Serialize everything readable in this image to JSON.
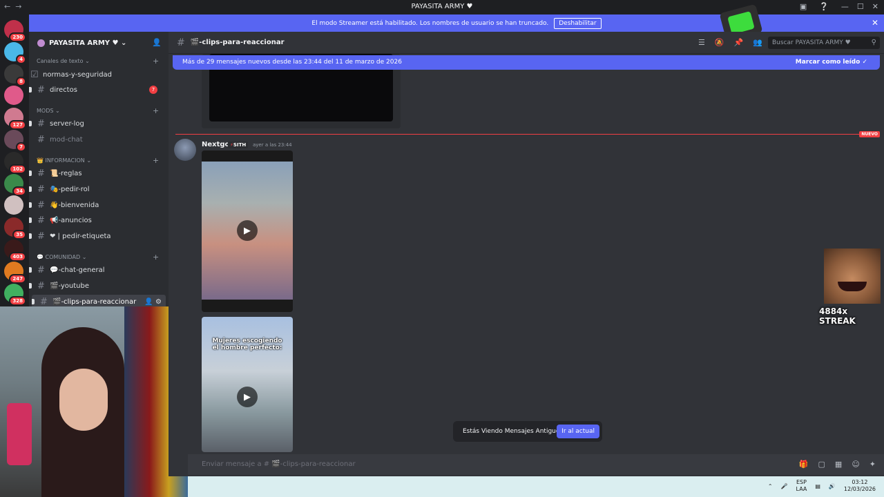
{
  "window": {
    "title": "PAYASITA ARMY ♥",
    "back": "←",
    "forward": "→",
    "minimize": "—",
    "maximize": "☐",
    "close": "✕"
  },
  "streamer_bar": {
    "text": "El modo Streamer está habilitado. Los nombres de usuario se han truncado.",
    "button": "Deshabilitar",
    "close": "✕"
  },
  "servers": [
    {
      "badge": "230",
      "color": "#c0304a"
    },
    {
      "badge": "4",
      "color": "#4ab8e8"
    },
    {
      "badge": "8",
      "color": "#3a3a3a"
    },
    {
      "badge": "",
      "color": "#e05a8a"
    },
    {
      "badge": "127",
      "color": "#d07a90"
    },
    {
      "badge": "7",
      "color": "#6a4a5a"
    },
    {
      "badge": "102",
      "color": "#2a2a2a"
    },
    {
      "badge": "34",
      "color": "#3a8a4a"
    },
    {
      "badge": "",
      "color": "#d0c0c0"
    },
    {
      "badge": "35",
      "color": "#8a2a2a"
    },
    {
      "badge": "403",
      "color": "#3a1a1a"
    },
    {
      "badge": "247",
      "color": "#e07a20"
    },
    {
      "badge": "328",
      "color": "#40b060"
    }
  ],
  "guild": {
    "name": "PAYASITA ARMY ♥"
  },
  "categories": {
    "text": "Canales de texto",
    "mods": "MODS",
    "info": "INFORMACION",
    "community": "COMUNIDAD"
  },
  "channels": {
    "normas": "normas-y-seguridad",
    "directos": "directos",
    "directos_mentions": "7",
    "serverlog": "server-log",
    "modchat": "mod-chat",
    "reglas": "📜-reglas",
    "pedirrol": "🎭-pedir-rol",
    "bienvenida": "👋-bienvenida",
    "anuncios": "📢-anuncios",
    "etiqueta": "❤ | pedir-etiqueta",
    "chatgeneral": "💬-chat-general",
    "youtube": "🎬-youtube",
    "clips": "🎬-clips-para-reaccionar"
  },
  "header": {
    "channel": "🎬-clips-para-reaccionar",
    "search_placeholder": "Buscar PAYASITA ARMY ♥"
  },
  "new_messages": {
    "text": "Más de 29 mensajes nuevos desde las 23:44 del 11 de marzo de 2026",
    "mark": "Marcar como leído"
  },
  "divider": {
    "label": "NUEVO"
  },
  "message": {
    "author": "Nextgo",
    "role": "SITH",
    "time": "ayer a las 23:44",
    "video2_caption": "Mujeres escogiendo el hombre perfecto:"
  },
  "old_messages": {
    "text": "Estás Viendo Mensajes Antiguos",
    "button": "Ir al actual"
  },
  "composer": {
    "placeholder": "Enviar mensaje a # 🎬-clips-para-reaccionar"
  },
  "overlay": {
    "streak": "4884x STREAK"
  },
  "taskbar": {
    "lang1": "ESP",
    "lang2": "LAA",
    "time": "03:12",
    "date": "12/03/2026"
  }
}
